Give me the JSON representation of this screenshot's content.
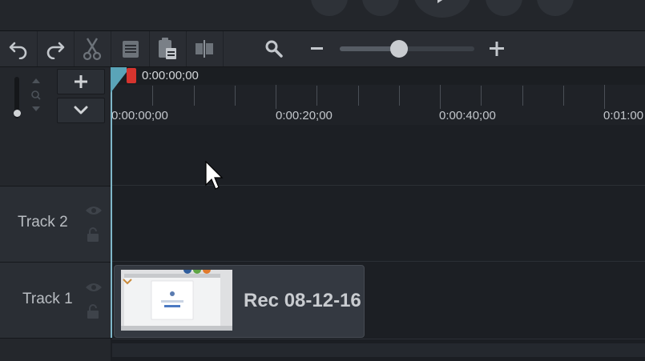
{
  "toolbar": {
    "buttons": [
      {
        "name": "undo-icon"
      },
      {
        "name": "redo-icon"
      },
      {
        "name": "cut-icon"
      },
      {
        "name": "copy-icon"
      },
      {
        "name": "paste-icon"
      },
      {
        "name": "split-icon"
      }
    ],
    "zoom": {
      "value": 0.43
    }
  },
  "playhead": {
    "time": "0:00:00;00"
  },
  "ruler": {
    "labels": [
      "0:00:00;00",
      "0:00:20;00",
      "0:00:40;00",
      "0:01:00"
    ]
  },
  "tracks": [
    {
      "name": "Track 2"
    },
    {
      "name": "Track 1"
    }
  ],
  "clip": {
    "label": "Rec 08-12-16"
  },
  "colors": {
    "playhead": "#7fb7c9",
    "playhead_marker": "#d6342e",
    "background": "#1b1e23"
  }
}
